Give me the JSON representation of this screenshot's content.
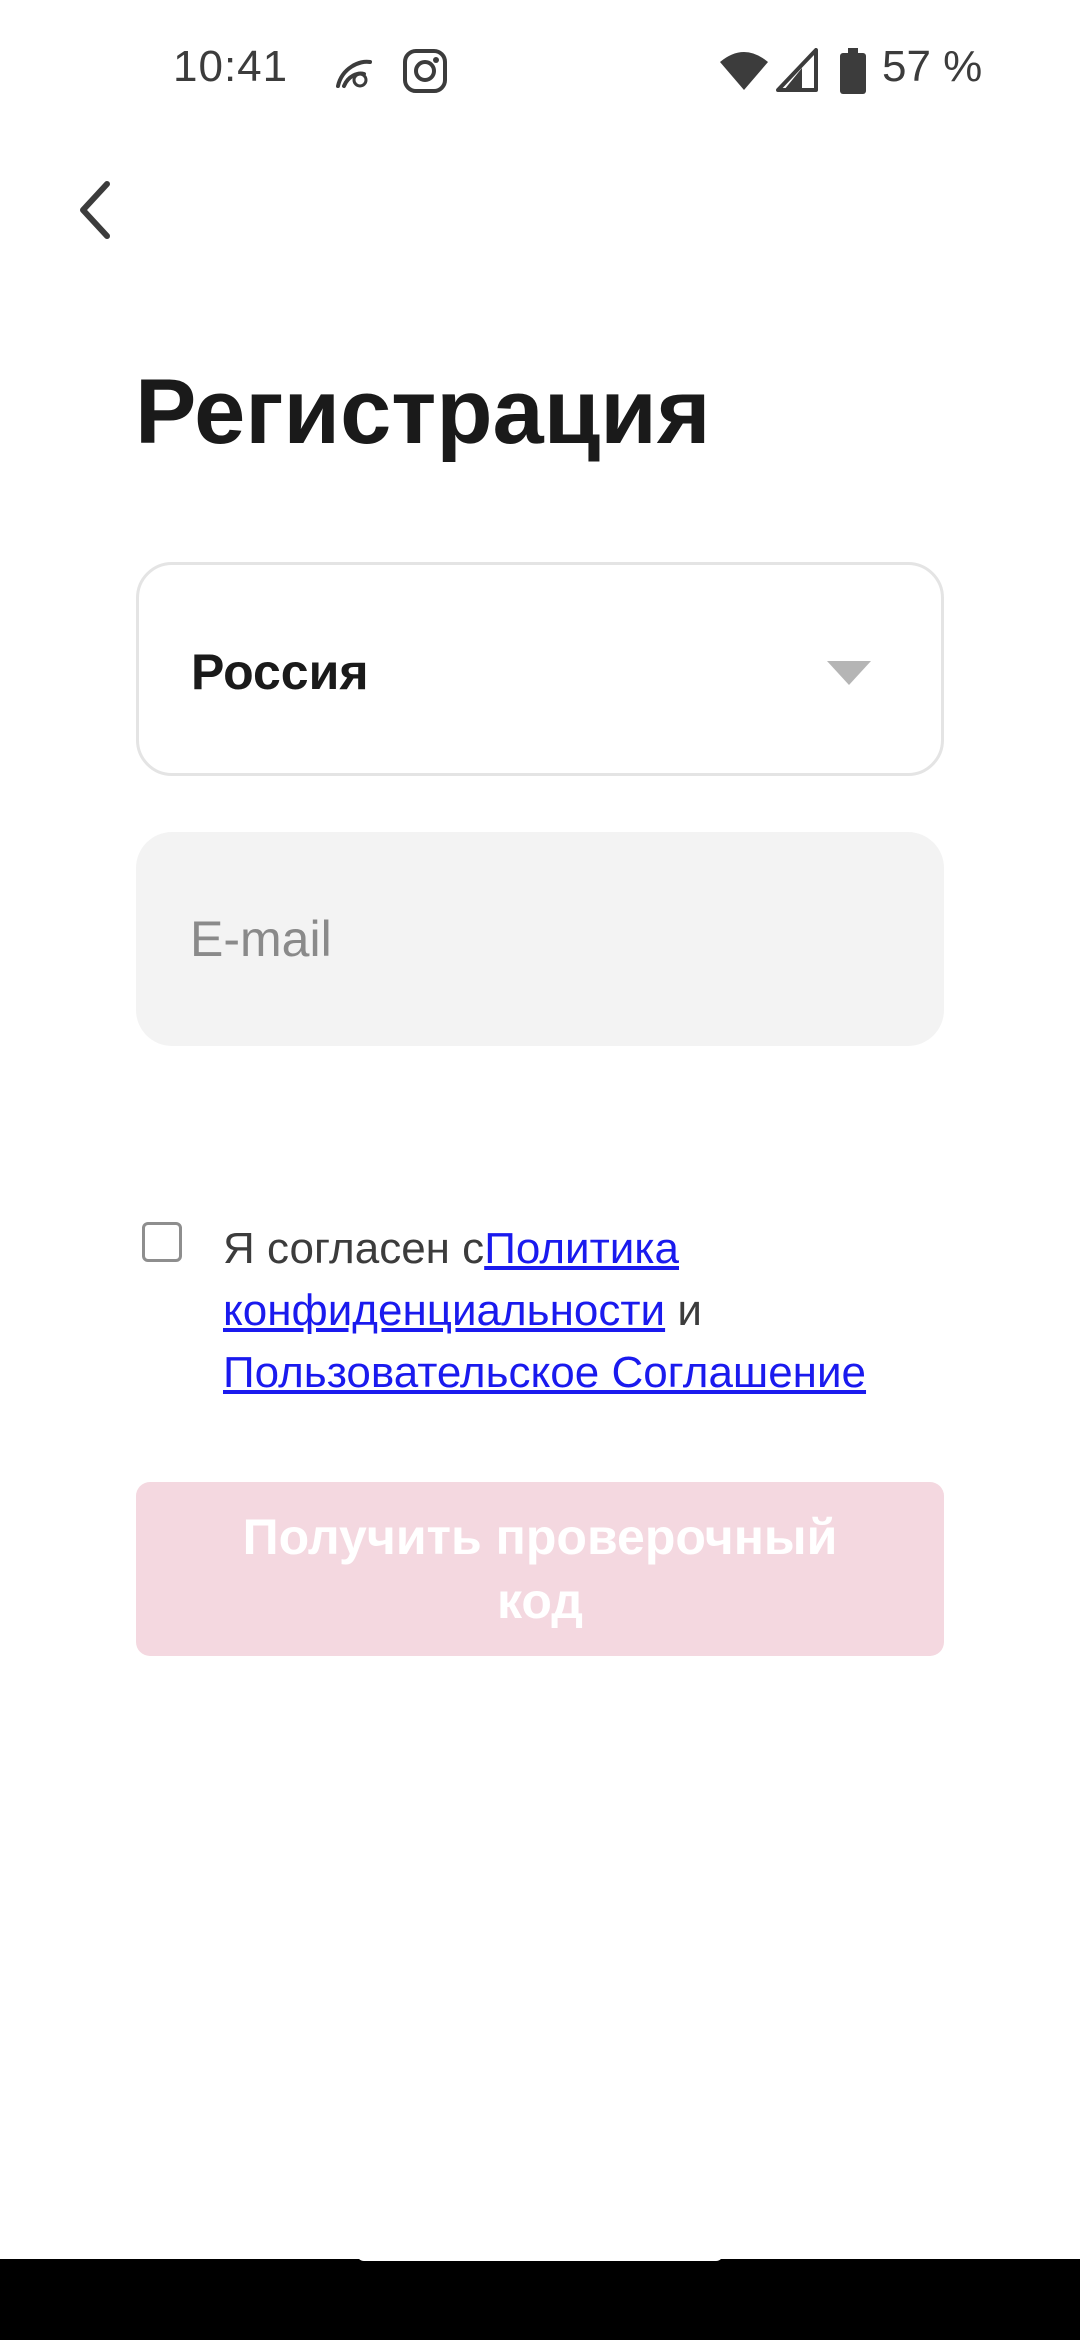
{
  "status_bar": {
    "time": "10:41",
    "battery": "57 %",
    "icons": [
      "meteor-app-icon",
      "instagram-icon",
      "wifi-icon",
      "cellular-signal-icon",
      "battery-icon"
    ]
  },
  "header": {
    "back_icon": "chevron-left-icon"
  },
  "page": {
    "title": "Регистрация"
  },
  "form": {
    "country": {
      "value": "Россия",
      "icon": "caret-down-icon"
    },
    "email": {
      "placeholder": "E-mail",
      "value": ""
    },
    "consent": {
      "checked": false,
      "prefix": "Я согласен с",
      "privacy_link": "Политика конфиденциальности",
      "conjunction": " и ",
      "terms_link": "Пользовательское Соглашение"
    },
    "submit_label": "Получить проверочный код"
  },
  "colors": {
    "accent_disabled": "#f4d8e0",
    "link": "#1a1aee",
    "input_fill": "#f3f3f3"
  }
}
